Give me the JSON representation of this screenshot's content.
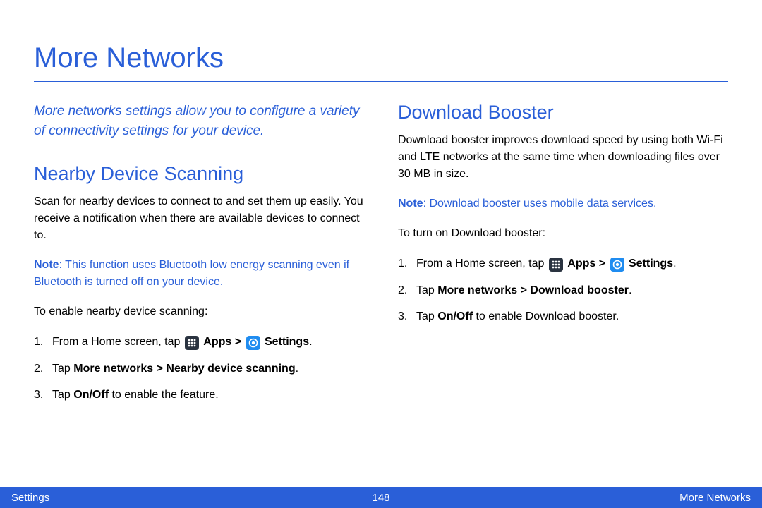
{
  "page": {
    "title": "More Networks",
    "intro": "More networks settings allow you to configure a variety of connectivity settings for your device."
  },
  "left": {
    "heading": "Nearby Device Scanning",
    "body": "Scan for nearby devices to connect to and set them up easily. You receive a notification when there are available devices to connect to.",
    "note_label": "Note",
    "note_body": ": This function uses Bluetooth low energy scanning even if Bluetooth is turned off on your device.",
    "instructions_lead": "To enable nearby device scanning:",
    "step1_prefix": "From a Home screen, tap ",
    "step1_apps": "Apps",
    "step1_sep": " > ",
    "step1_settings": "Settings",
    "step1_suffix": ".",
    "step2_prefix": "Tap ",
    "step2_bold": "More networks > Nearby device scanning",
    "step2_suffix": ".",
    "step3_prefix": "Tap ",
    "step3_bold": "On/Off",
    "step3_suffix": " to enable the feature."
  },
  "right": {
    "heading": "Download Booster",
    "body": "Download booster improves download speed by using both Wi-Fi and LTE networks at the same time when downloading files over 30 MB in size.",
    "note_label": "Note",
    "note_body": ": Download booster uses mobile data services.",
    "instructions_lead": "To turn on Download booster:",
    "step1_prefix": "From a Home screen, tap ",
    "step1_apps": "Apps",
    "step1_sep": " > ",
    "step1_settings": "Settings",
    "step1_suffix": ".",
    "step2_prefix": "Tap ",
    "step2_bold": "More networks > Download booster",
    "step2_suffix": ".",
    "step3_prefix": "Tap ",
    "step3_bold": "On/Off",
    "step3_suffix": " to enable Download booster."
  },
  "footer": {
    "left": "Settings",
    "center": "148",
    "right": "More Networks"
  }
}
